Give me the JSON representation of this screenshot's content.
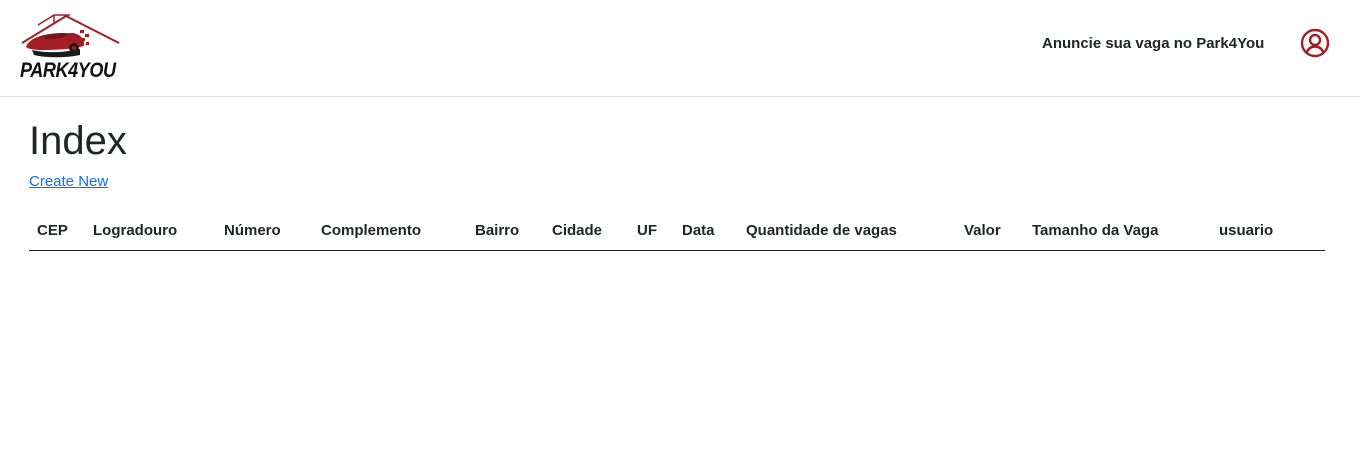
{
  "brand": {
    "name": "PARK4YOU",
    "colors": {
      "accent": "#a31f25",
      "text": "#212529",
      "link": "#0d6efd"
    }
  },
  "header": {
    "nav_link": "Anuncie sua vaga no Park4You",
    "user_icon": "user-circle-icon"
  },
  "main": {
    "title": "Index",
    "create_link": "Create New",
    "table": {
      "columns": [
        "CEP",
        "Logradouro",
        "Número",
        "Complemento",
        "Bairro",
        "Cidade",
        "UF",
        "Data",
        "Quantidade de vagas",
        "Valor",
        "Tamanho da Vaga",
        "usuario"
      ],
      "rows": []
    }
  }
}
